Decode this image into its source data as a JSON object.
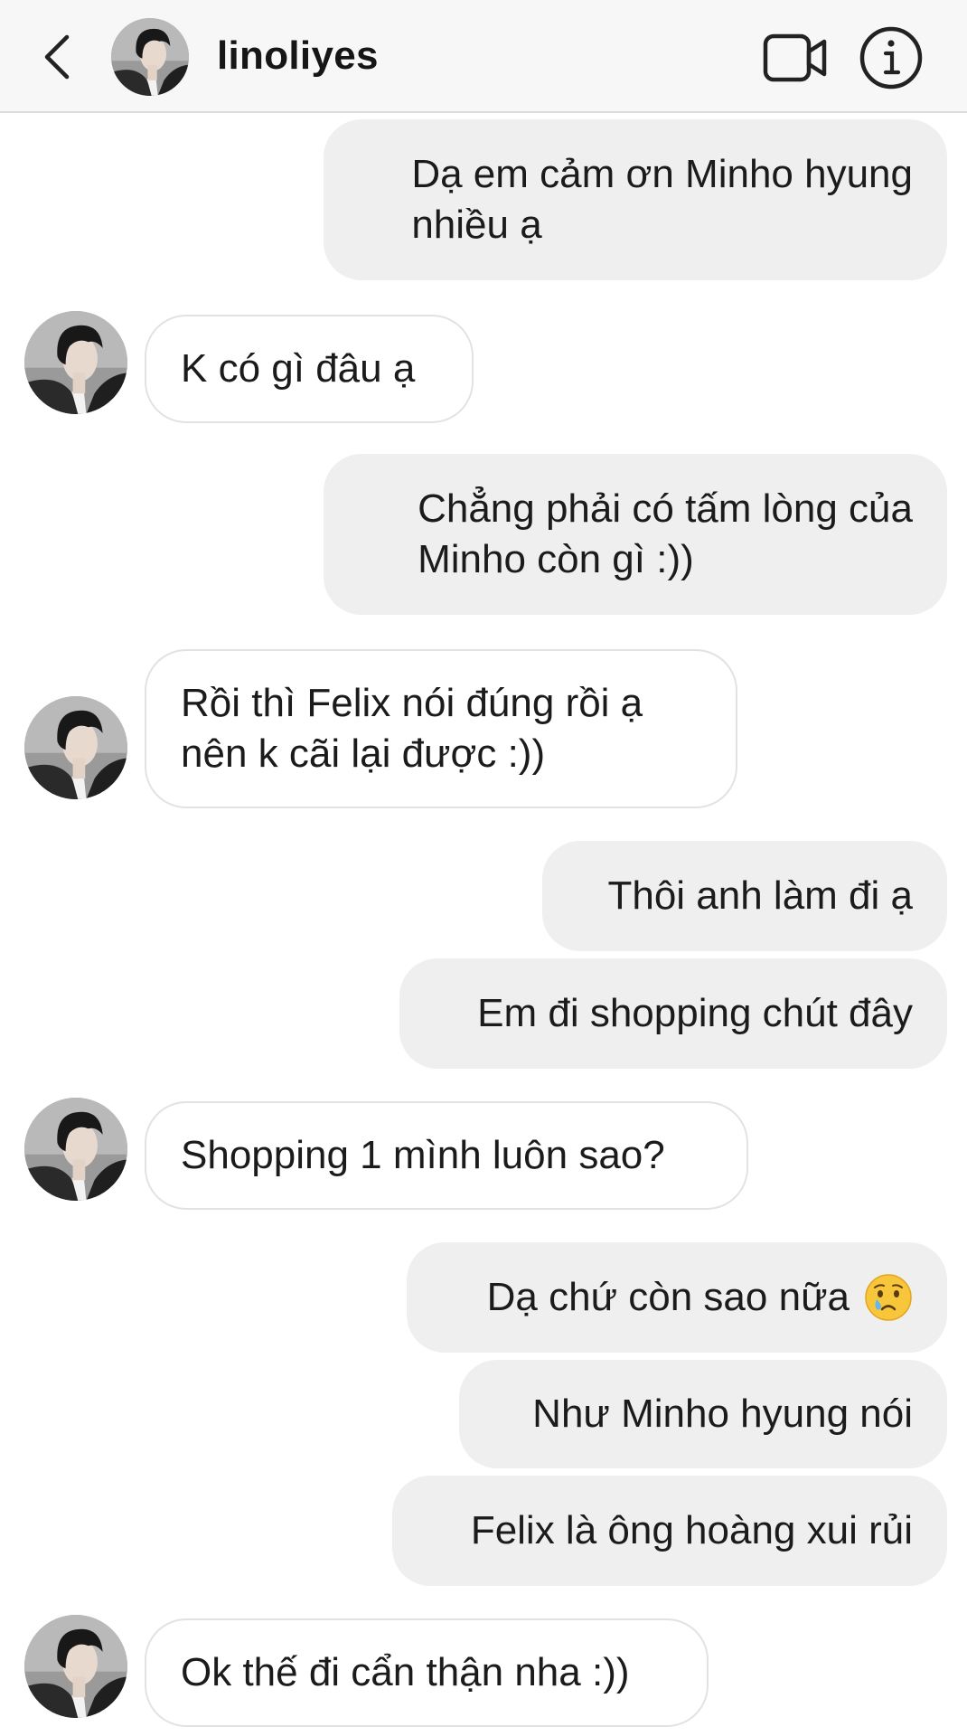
{
  "header": {
    "username": "linoliyes",
    "back_icon": "chevron-left-icon",
    "video_icon": "video-camera-icon",
    "info_icon": "info-icon"
  },
  "colors": {
    "sent_bubble": "#efefef",
    "received_bubble_border": "#e2e2e2",
    "header_bg": "#f7f7f7"
  },
  "messages": [
    {
      "side": "sent",
      "text": "Dạ em cảm ơn Minho hyung\nnhiều ạ"
    },
    {
      "side": "received",
      "text": "K có gì đâu ạ"
    },
    {
      "side": "sent",
      "text": "Chẳng phải có tấm lòng của\nMinho còn gì :))"
    },
    {
      "side": "received",
      "text": "Rồi thì Felix nói đúng rồi ạ\nnên k cãi lại được :))"
    },
    {
      "side": "sent",
      "text": "Thôi anh làm đi ạ"
    },
    {
      "side": "sent",
      "text": "Em đi shopping chút đây"
    },
    {
      "side": "received",
      "text": "Shopping 1 mình luôn sao?"
    },
    {
      "side": "sent",
      "text": "Dạ chứ còn sao nữa",
      "emoji": "crying-face-emoji"
    },
    {
      "side": "sent",
      "text": "Như Minho hyung nói"
    },
    {
      "side": "sent",
      "text": "Felix là ông hoàng xui rủi"
    },
    {
      "side": "received",
      "text": "Ok thế đi cẩn thận nha :))"
    }
  ]
}
